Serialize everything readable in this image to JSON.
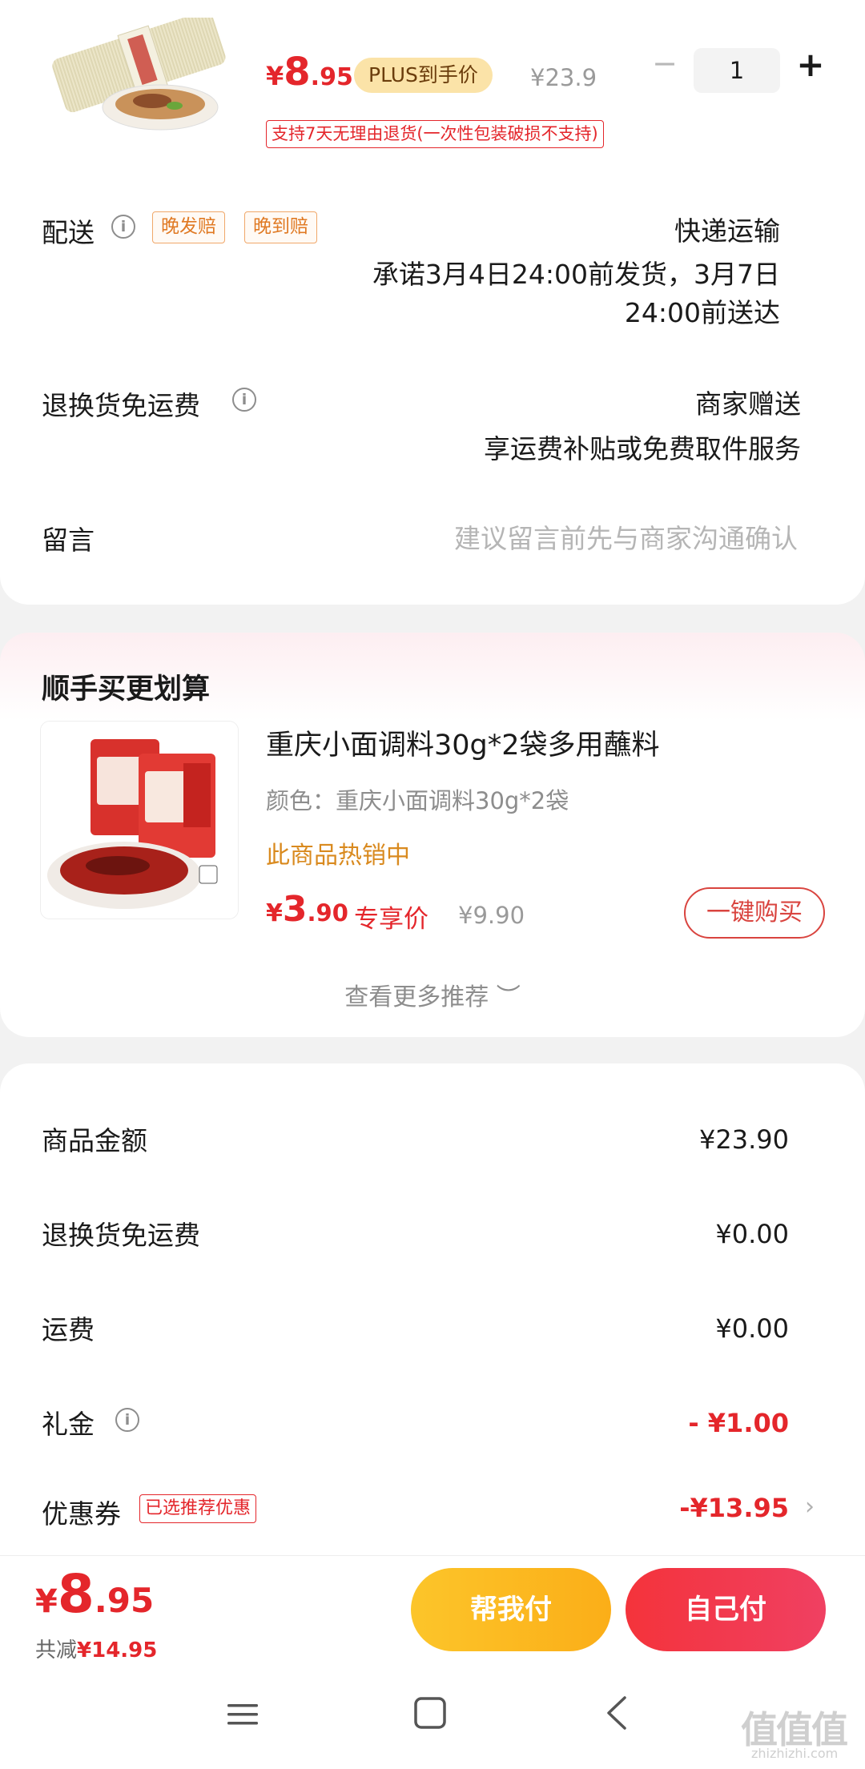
{
  "product": {
    "price_currency": "¥",
    "price_int": "8",
    "price_dec": ".95",
    "plus_tag": "PLUS到手价",
    "orig_price": "¥23.9",
    "qty_minus": "−",
    "qty": "1",
    "qty_plus": "+",
    "return_policy": "支持7天无理由退货(一次性包装破损不支持)"
  },
  "delivery": {
    "label": "配送",
    "tags": [
      "晚发赔",
      "晚到赔"
    ],
    "method": "快递运输",
    "promise_line1": "承诺3月4日24:00前发货，3月7日",
    "promise_line2": "24:00前送达"
  },
  "return_shipping": {
    "label": "退换货免运费",
    "value_line1": "商家赠送",
    "value_line2": "享运费补贴或免费取件服务"
  },
  "message": {
    "label": "留言",
    "placeholder": "建议留言前先与商家沟通确认"
  },
  "upsell": {
    "title": "顺手买更划算",
    "name": "重庆小面调料30g*2袋多用蘸料",
    "spec": "颜色：重庆小面调料30g*2袋",
    "hot": "此商品热销中",
    "price_currency": "¥",
    "price_int": "3",
    "price_dec": ".90",
    "exclusive": "专享价",
    "orig_price": "¥9.90",
    "buy_button": "一键购买",
    "more": "查看更多推荐 ︶"
  },
  "summary": {
    "goods_label": "商品金额",
    "goods_value": "¥23.90",
    "return_label": "退换货免运费",
    "return_value": "¥0.00",
    "shipping_label": "运费",
    "shipping_value": "¥0.00",
    "gift_label": "礼金",
    "gift_value": "- ¥1.00",
    "coupon_label": "优惠券",
    "coupon_tag": "已选推荐优惠",
    "coupon_value": "-¥13.95",
    "coupon_chevron": "›"
  },
  "bottom": {
    "total_currency": "¥",
    "total_int": "8",
    "total_dec": ".95",
    "save_label": "共减",
    "save_value": "¥14.95",
    "help_pay": "帮我付",
    "self_pay": "自己付"
  },
  "watermark": {
    "logo": "值值值",
    "url": "zhizhizhi.com"
  },
  "colors": {
    "red": "#e4262b",
    "orange": "#e07a24",
    "yellow_button": "#fbae18",
    "red_button": "#f4333b"
  },
  "icons": {
    "info": "info-icon",
    "menu": "menu-icon",
    "home": "home-icon",
    "back": "back-icon"
  }
}
